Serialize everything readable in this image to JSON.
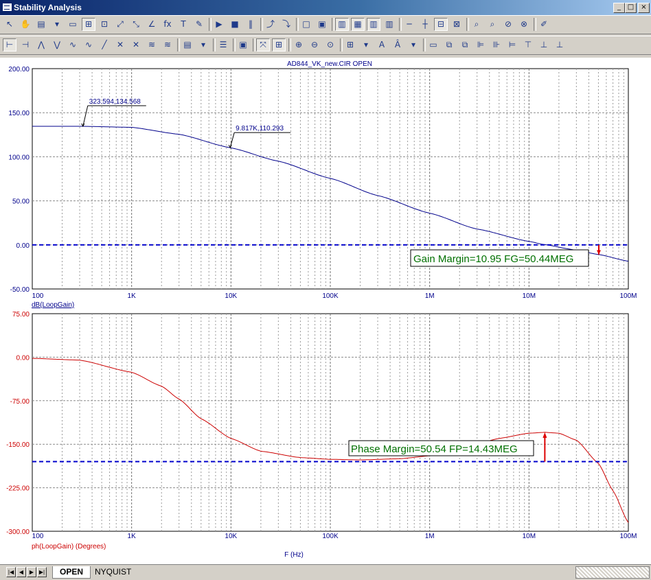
{
  "window": {
    "title": "Stability Analysis",
    "minimize": "_",
    "maximize": "□",
    "close": "×"
  },
  "plot_title": "AD844_VK_new.CIR OPEN",
  "x_axis": {
    "label": "F (Hz)",
    "scale": "log",
    "ticks": [
      "100",
      "1K",
      "10K",
      "100K",
      "1M",
      "10M",
      "100M"
    ],
    "ticks_bottom": [
      "100",
      "1K",
      "10K",
      "100K",
      "1M",
      "10M",
      "100M"
    ]
  },
  "gain_plot": {
    "ylabel": "dB(LoopGain)",
    "yticks": [
      "200.00",
      "150.00",
      "100.00",
      "50.00",
      "0.00",
      "-50.00"
    ],
    "color": "#00008b",
    "annotations": [
      {
        "label": "323.594,134.568"
      },
      {
        "label": "9.817K,110.293"
      }
    ],
    "margin_label": "Gain Margin=10.95 FG=50.44MEG"
  },
  "phase_plot": {
    "ylabel": "ph(LoopGain) (Degrees)",
    "yticks": [
      "75.00",
      "0.00",
      "-75.00",
      "-150.00",
      "-225.00",
      "-300.00"
    ],
    "color": "#cc0000",
    "margin_label": "Phase Margin=50.54 FP=14.43MEG"
  },
  "tabs": {
    "open": "OPEN",
    "nyquist": "NYQUIST"
  },
  "chart_data": [
    {
      "type": "line",
      "title": "AD844_VK_new.CIR OPEN",
      "xlabel": "F (Hz)",
      "ylabel": "dB(LoopGain)",
      "xscale": "log",
      "xlim": [
        100,
        100000000
      ],
      "ylim": [
        -50,
        200
      ],
      "grid": true,
      "series": [
        {
          "name": "dB(LoopGain)",
          "x": [
            100,
            323.594,
            1000,
            3000,
            9817,
            30000,
            100000,
            300000,
            1000000,
            3000000,
            10000000,
            14000000,
            30000000,
            50440000,
            100000000
          ],
          "y": [
            134.57,
            134.568,
            133.4,
            125.5,
            110.293,
            95,
            75.5,
            56,
            36,
            18,
            4,
            0.5,
            -6,
            -10.95,
            -18.5
          ]
        },
        {
          "name": "0 dB reference",
          "x": [
            100,
            100000000
          ],
          "y": [
            0,
            0
          ]
        }
      ],
      "annotations": [
        {
          "text": "323.594,134.568",
          "x": 323.594,
          "y": 134.568
        },
        {
          "text": "9.817K,110.293",
          "x": 9817,
          "y": 110.293
        },
        {
          "text": "Gain Margin=10.95 FG=50.44MEG",
          "x": 50440000,
          "y": -10.95
        }
      ]
    },
    {
      "type": "line",
      "xlabel": "F (Hz)",
      "ylabel": "ph(LoopGain) (Degrees)",
      "xscale": "log",
      "xlim": [
        100,
        100000000
      ],
      "ylim": [
        -300,
        75
      ],
      "grid": true,
      "series": [
        {
          "name": "ph(LoopGain) (Degrees)",
          "x": [
            100,
            300,
            1000,
            2000,
            3000,
            5000,
            10000,
            20000,
            50000,
            100000,
            200000,
            500000,
            1000000,
            2000000,
            5000000,
            10000000,
            14430000,
            20000000,
            30000000,
            50000000,
            70000000,
            100000000
          ],
          "y": [
            -2,
            -5,
            -26,
            -50,
            -72,
            -106,
            -140,
            -162,
            -173,
            -176,
            -177,
            -175,
            -170,
            -159,
            -140,
            -131,
            -129.46,
            -131,
            -143,
            -183,
            -230,
            -285
          ]
        },
        {
          "name": "-180 reference",
          "x": [
            100,
            100000000
          ],
          "y": [
            -180,
            -180
          ]
        }
      ],
      "annotations": [
        {
          "text": "Phase Margin=50.54 FP=14.43MEG",
          "x": 14430000,
          "y": -129.46
        }
      ]
    }
  ]
}
